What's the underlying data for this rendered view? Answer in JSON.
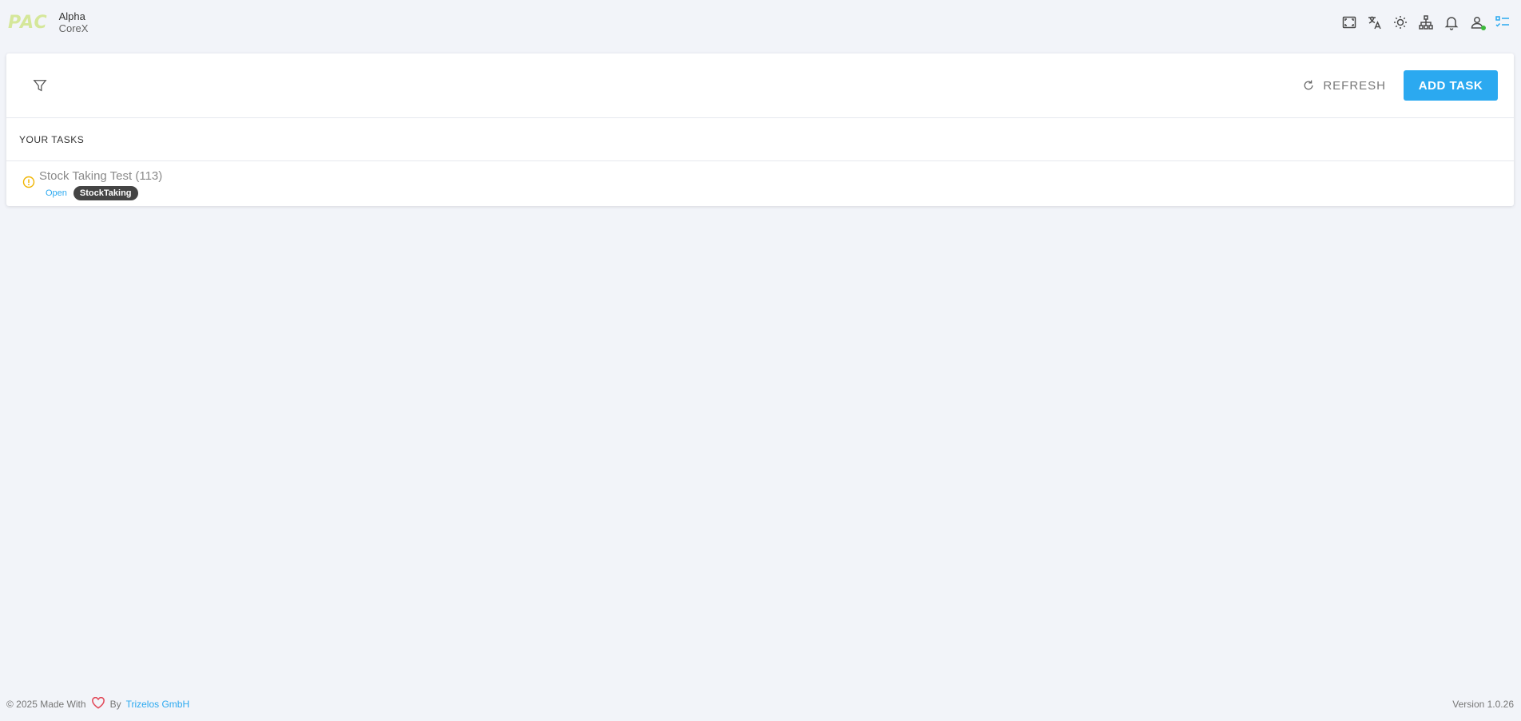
{
  "brand": {
    "logo_text": "PAC",
    "name": "Alpha",
    "subtitle": "CoreX"
  },
  "top_icons": [
    "fullscreen-icon",
    "translate-icon",
    "theme-icon",
    "org-chart-icon",
    "bell-icon",
    "user-icon",
    "task-list-icon"
  ],
  "toolbar": {
    "refresh_label": "REFRESH",
    "add_label": "ADD TASK"
  },
  "tasks_section": {
    "title": "YOUR TASKS",
    "items": [
      {
        "title": "Stock Taking Test (113)",
        "status": "Open",
        "tag": "StockTaking"
      }
    ]
  },
  "footer": {
    "copyright": "© 2025 Made With",
    "by": "By",
    "company": "Trizelos GmbH",
    "version": "Version 1.0.26"
  },
  "colors": {
    "accent": "#2ba9f0",
    "background": "#f2f4f9",
    "warning": "#f0b400",
    "logo": "#d5e79a"
  }
}
